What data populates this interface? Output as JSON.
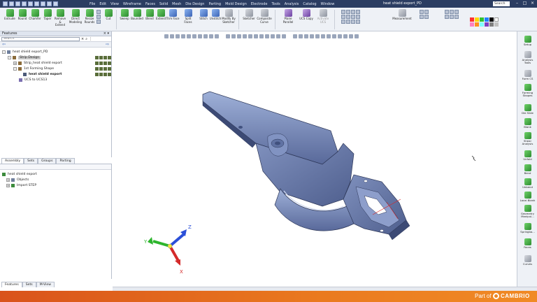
{
  "title_bar": {
    "menu": [
      "File",
      "Edit",
      "View",
      "Wireframe",
      "Faces",
      "Solid",
      "Mesh",
      "Die Design",
      "Parting",
      "Mold Design",
      "Electrode",
      "Tools",
      "Analysis",
      "Catalog",
      "Window"
    ],
    "document": "heat shield export_PD",
    "search": "Search"
  },
  "ribbon": {
    "buttons": [
      "Extrude",
      "Round",
      "Chamfer",
      "Taper",
      "Remove &\nExtend",
      "Direct\nModeling",
      "Resize\nRounds",
      "Cut",
      "Sweep",
      "Bounded",
      "Blend",
      "Extend",
      "Trim Face",
      "Split Faces",
      "Stitch",
      "Unstitch",
      "Modify By\nSketcher",
      "Sketcher",
      "Composite\nCurve",
      "Plane Parallel",
      "UCS Copy",
      "Activate UCS",
      "Measurement"
    ]
  },
  "features_panel": {
    "title": "Features",
    "search_placeholder": "Search",
    "tree": [
      "heat shield export_PD",
      "Strip Design",
      "Strip_heat shield export",
      "1st Forming Shape",
      "heat shield export",
      "UCS to UCS13"
    ],
    "tabs": [
      "Assembly",
      "Sets",
      "Groups",
      "Parting"
    ]
  },
  "objects_panel": {
    "tree": [
      "heat shield export",
      "Objects",
      "Import STEP"
    ]
  },
  "bottom_tabs": [
    "Features",
    "Sets",
    "M-View"
  ],
  "axes": {
    "x": "X",
    "y": "Y",
    "z": "Z"
  },
  "right_panel": [
    "Setup",
    "Analysis\nTools",
    "Form CS",
    "Forming\nShapes",
    "Die Slide",
    "Blank",
    "Shear\nAnalysis",
    "Unfold",
    "Bend",
    "Unbend",
    "Local Blank",
    "Geometry\nManipul...",
    "Springba...",
    "Faces",
    "Curves"
  ],
  "footer": {
    "part_of": "Part of",
    "brand": "CAMBRIO"
  },
  "colors": {
    "title_bg": "#2b3d62",
    "footer_orange": "#e06a1d",
    "part_blue": "#5b6fa0"
  }
}
